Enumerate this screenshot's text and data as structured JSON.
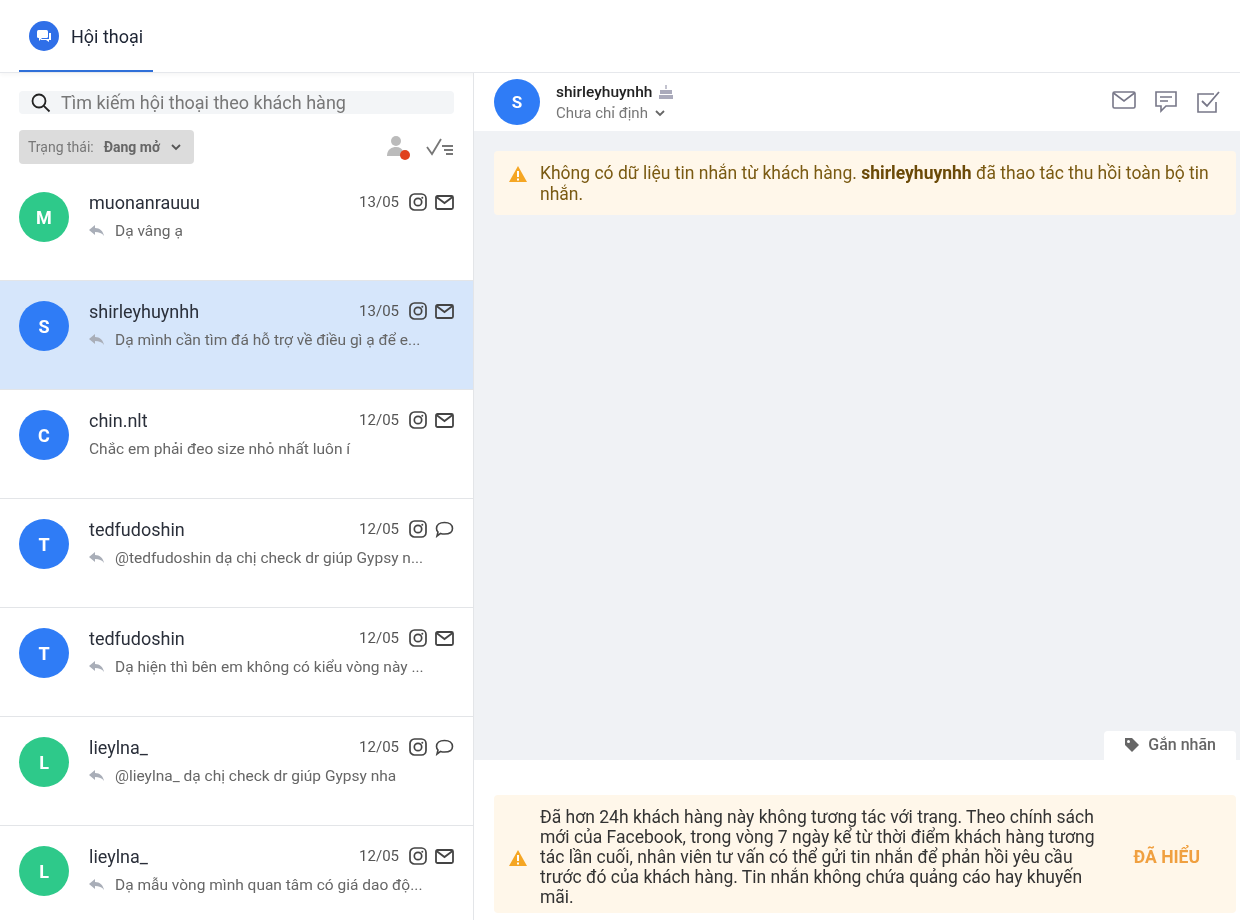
{
  "tabs": [
    {
      "label": "Hội thoại",
      "selected": true
    }
  ],
  "search": {
    "placeholder": "Tìm kiếm hội thoại theo khách hàng"
  },
  "filter": {
    "label": "Trạng thái:",
    "value": "Đang mở"
  },
  "conversations": [
    {
      "initial": "M",
      "color": "#2ec98a",
      "name": "muonanrauuu",
      "date": "13/05",
      "kind": "email",
      "replied": true,
      "preview": "Dạ vâng ạ",
      "selected": false
    },
    {
      "initial": "S",
      "color": "#2f7cf6",
      "name": "shirleyhuynhh",
      "date": "13/05",
      "kind": "email",
      "replied": true,
      "preview": "Dạ mình cần tìm đá hỗ trợ về điều gì ạ để e...",
      "selected": true
    },
    {
      "initial": "C",
      "color": "#2f7cf6",
      "name": "chin.nlt",
      "date": "12/05",
      "kind": "email",
      "replied": false,
      "preview": "Chắc em phải đeo size nhỏ nhất luôn í",
      "selected": false
    },
    {
      "initial": "T",
      "color": "#2f7cf6",
      "name": "tedfudoshin",
      "date": "12/05",
      "kind": "comment",
      "replied": true,
      "preview": "@tedfudoshin dạ chị check dr giúp Gypsy n...",
      "selected": false
    },
    {
      "initial": "T",
      "color": "#2f7cf6",
      "name": "tedfudoshin",
      "date": "12/05",
      "kind": "email",
      "replied": true,
      "preview": "Dạ hiện thì bên em không có kiểu vòng này ...",
      "selected": false
    },
    {
      "initial": "L",
      "color": "#2ec98a",
      "name": "lieylna_",
      "date": "12/05",
      "kind": "comment",
      "replied": true,
      "preview": "@lieylna_ dạ chị check dr giúp Gypsy nha",
      "selected": false
    },
    {
      "initial": "L",
      "color": "#2ec98a",
      "name": "lieylna_",
      "date": "12/05",
      "kind": "email",
      "replied": true,
      "preview": "Dạ mẫu vòng mình quan tâm có giá dao độ...",
      "selected": false
    }
  ],
  "chat": {
    "initial": "S",
    "color": "#2f7cf6",
    "name": "shirleyhuynhh",
    "assignee": "Chưa chỉ định",
    "notice": "Không có dữ liệu tin nhắn từ khách hàng. **shirleyhuynhh** đã thao tác thu hồi toàn bộ tin nhắn.",
    "tag_button": "Gắn nhãn",
    "policy_warning": "Đã hơn 24h khách hàng này không tương tác với trang. Theo chính sách mới của Facebook, trong vòng 7 ngày kể từ thời điểm khách hàng tương tác lần cuối, nhân viên tư vấn có thể gửi tin nhắn để phản hồi yêu cầu trước đó của khách hàng. Tin nhắn không chứa quảng cáo hay khuyến mãi.",
    "acknowledge_button": "ĐÃ HIỂU"
  }
}
